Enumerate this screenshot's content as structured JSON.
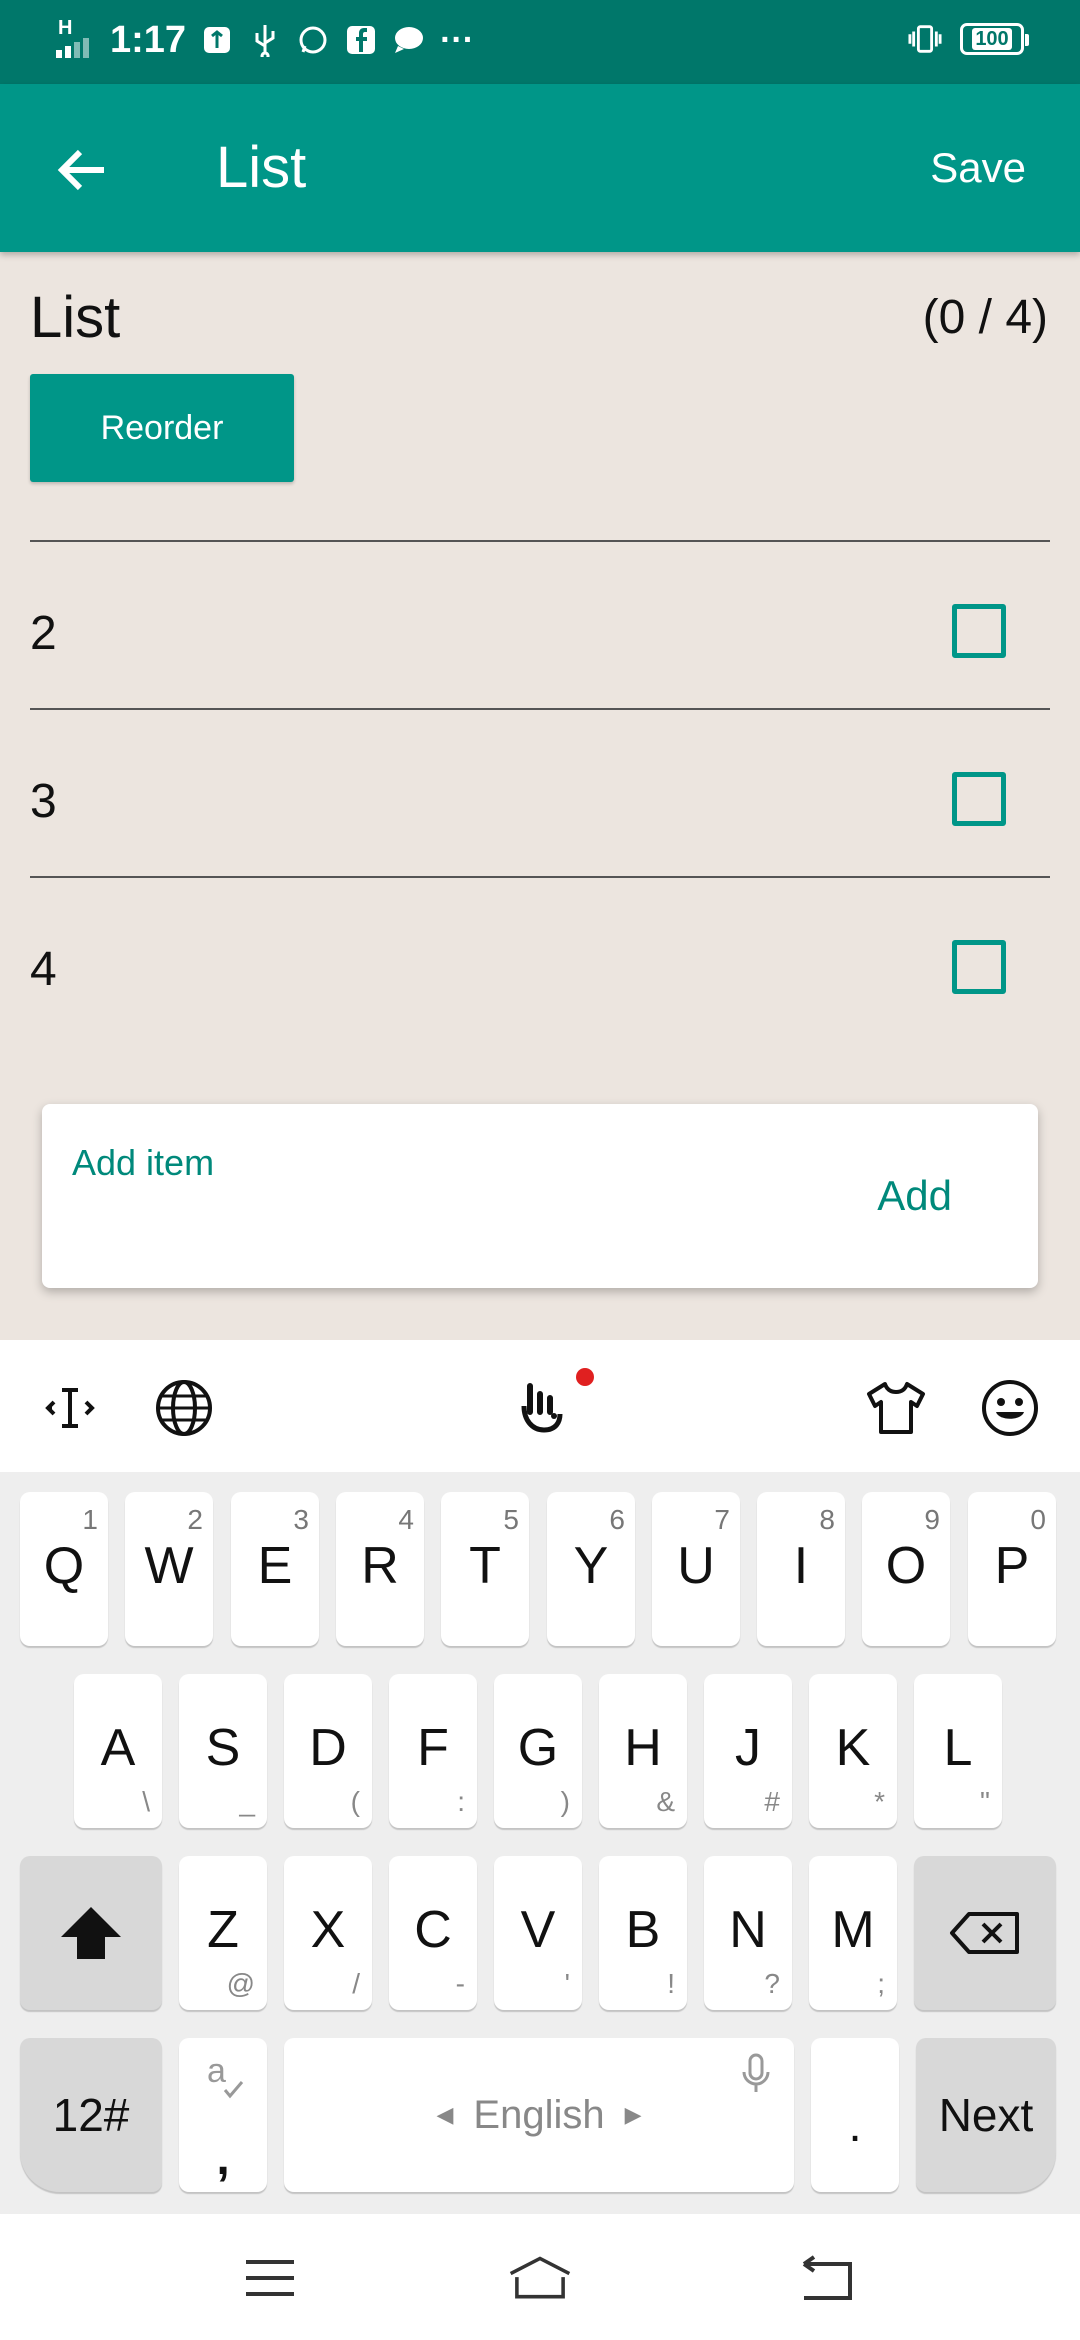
{
  "status_bar": {
    "network": "H",
    "time": "1:17",
    "more": "···",
    "battery": "100"
  },
  "app_bar": {
    "title": "List",
    "save_label": "Save"
  },
  "list": {
    "title": "List",
    "count": "(0 / 4)",
    "reorder_label": "Reorder",
    "items": [
      {
        "label": "2",
        "checked": false
      },
      {
        "label": "3",
        "checked": false
      },
      {
        "label": "4",
        "checked": false
      }
    ]
  },
  "add_item": {
    "placeholder": "Add item",
    "button_label": "Add"
  },
  "keyboard": {
    "row1": [
      {
        "key": "Q",
        "alt": "1"
      },
      {
        "key": "W",
        "alt": "2"
      },
      {
        "key": "E",
        "alt": "3"
      },
      {
        "key": "R",
        "alt": "4"
      },
      {
        "key": "T",
        "alt": "5"
      },
      {
        "key": "Y",
        "alt": "6"
      },
      {
        "key": "U",
        "alt": "7"
      },
      {
        "key": "I",
        "alt": "8"
      },
      {
        "key": "O",
        "alt": "9"
      },
      {
        "key": "P",
        "alt": "0"
      }
    ],
    "row2": [
      {
        "key": "A",
        "alt": "\\"
      },
      {
        "key": "S",
        "alt": "_"
      },
      {
        "key": "D",
        "alt": "("
      },
      {
        "key": "F",
        "alt": ":"
      },
      {
        "key": "G",
        "alt": ")"
      },
      {
        "key": "H",
        "alt": "&"
      },
      {
        "key": "J",
        "alt": "#"
      },
      {
        "key": "K",
        "alt": "*"
      },
      {
        "key": "L",
        "alt": "\""
      }
    ],
    "row3": [
      {
        "key": "Z",
        "alt": "@"
      },
      {
        "key": "X",
        "alt": "/"
      },
      {
        "key": "C",
        "alt": "-"
      },
      {
        "key": "V",
        "alt": "'"
      },
      {
        "key": "B",
        "alt": "!"
      },
      {
        "key": "N",
        "alt": "?"
      },
      {
        "key": "M",
        "alt": ";"
      }
    ],
    "symbols_label": "12#",
    "comma_label": ",",
    "space_label": "English",
    "period_label": ".",
    "next_label": "Next"
  },
  "colors": {
    "primary": "#009688",
    "status_bar": "#00776a",
    "background": "#ece5df"
  }
}
